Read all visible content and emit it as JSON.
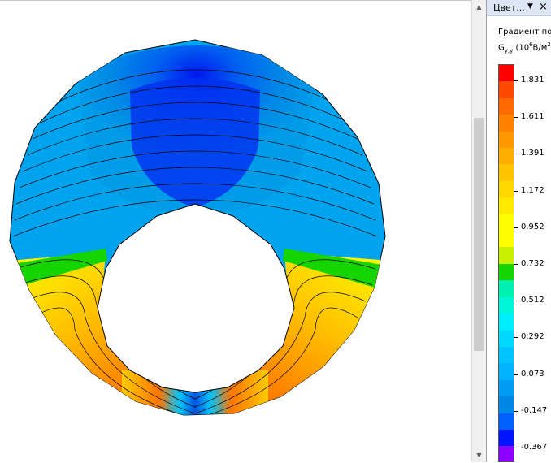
{
  "panel": {
    "title": "Цвет...",
    "dropdown_icon": "chevron-down-icon",
    "close_icon": "close-icon"
  },
  "legend": {
    "title": "Градиент пол",
    "unit_main": "G",
    "unit_sub": "y,y",
    "unit_open": " (10",
    "unit_exp": "6",
    "unit_mid": "В/м",
    "unit_exp2": "2",
    "unit_close": ")",
    "ticks": [
      "1.831",
      "1.611",
      "1.391",
      "1.172",
      "0.952",
      "0.732",
      "0.512",
      "0.292",
      "0.073",
      "-0.147",
      "-0.367"
    ],
    "colors": [
      "#ff0000",
      "#ff4a00",
      "#ff6a00",
      "#ff8200",
      "#ff9800",
      "#ffae00",
      "#ffc600",
      "#ffd800",
      "#ffea00",
      "#ffff00",
      "#ffff00",
      "#c8f000",
      "#16d400",
      "#00f0b0",
      "#00f6d8",
      "#00ecff",
      "#00d8ff",
      "#00c4ff",
      "#00b2ff",
      "#009cf4",
      "#0088e6",
      "#0060ff",
      "#0014ff",
      "#8c00ff"
    ]
  },
  "scrollbar": {
    "up_icon": "arrow-up-icon",
    "down_icon": "arrow-down-icon"
  }
}
